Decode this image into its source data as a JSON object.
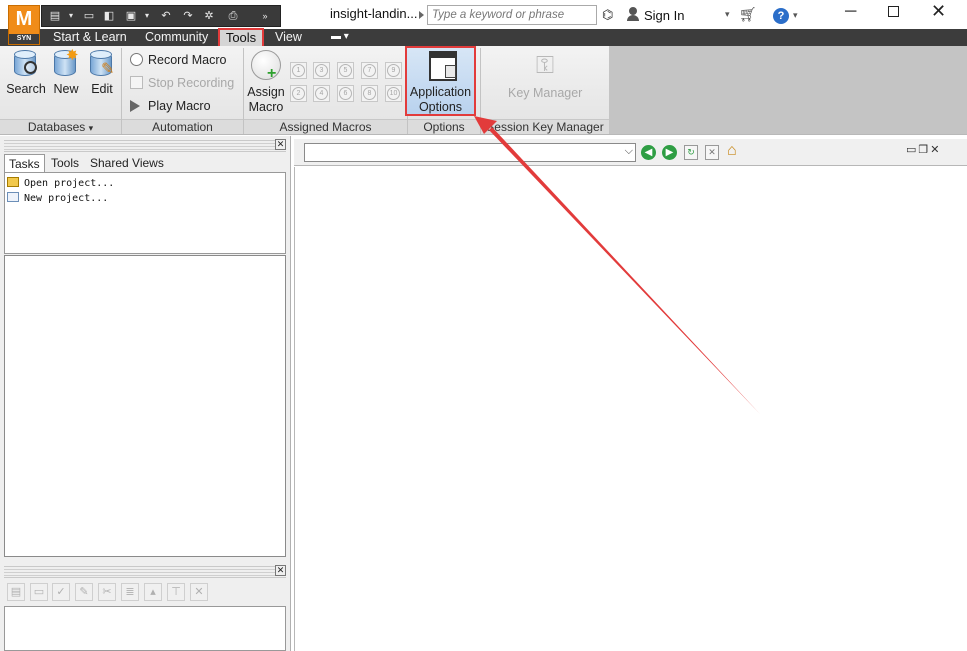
{
  "app": {
    "logo_letter": "M",
    "logo_sub": "SYN",
    "doc_title": "insight-landin..."
  },
  "search": {
    "placeholder": "Type a keyword or phrase"
  },
  "account": {
    "signin_label": "Sign In"
  },
  "help": {
    "label": "?"
  },
  "tabs": [
    "Start & Learn",
    "Community",
    "Tools",
    "View"
  ],
  "active_tab": "Tools",
  "ribbon": {
    "databases": {
      "buttons": [
        {
          "label": "Search",
          "icon": "db-search-icon"
        },
        {
          "label": "New",
          "icon": "db-new-icon"
        },
        {
          "label": "Edit",
          "icon": "db-edit-icon"
        }
      ],
      "group_label": "Databases"
    },
    "automation": {
      "record": "Record Macro",
      "stop": "Stop Recording",
      "play": "Play Macro",
      "group_label": "Automation"
    },
    "assigned": {
      "assign_label_1": "Assign",
      "assign_label_2": "Macro",
      "slots_top": [
        "1",
        "3",
        "5",
        "7",
        "9"
      ],
      "slots_bottom": [
        "2",
        "4",
        "6",
        "8",
        "10"
      ],
      "group_label": "Assigned Macros"
    },
    "options": {
      "label_1": "Application",
      "label_2": "Options",
      "group_label": "Options"
    },
    "session_key": {
      "label": "Key Manager",
      "group_label": "Session Key Manager"
    }
  },
  "left_panel": {
    "tabs": [
      "Tasks",
      "Tools",
      "Shared Views"
    ],
    "active_tab": "Tasks",
    "tasks": [
      "Open project...",
      "New project..."
    ]
  },
  "colors": {
    "highlight": "#e23b3b",
    "brand": "#f08c19",
    "ribbon_dark": "#3c3c3c"
  }
}
